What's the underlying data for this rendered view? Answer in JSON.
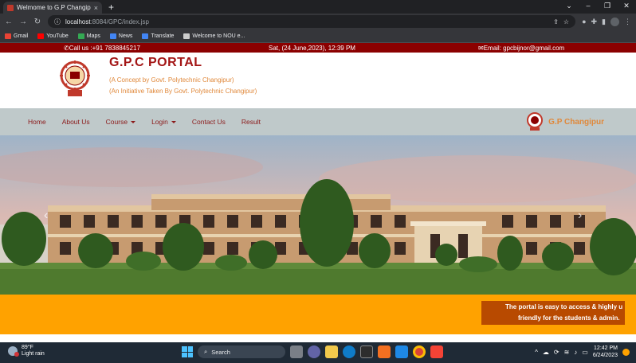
{
  "browser": {
    "tab_title": "Welmome to G.P Changipur Port",
    "close_glyph": "×",
    "new_tab_glyph": "+",
    "url_host": "localhost",
    "url_path": ":8084/GPC/index.jsp",
    "bookmarks": [
      {
        "label": "Gmail",
        "color": "#ea4335"
      },
      {
        "label": "YouTube",
        "color": "#ff0000"
      },
      {
        "label": "Maps",
        "color": "#34a853"
      },
      {
        "label": "News",
        "color": "#4285f4"
      },
      {
        "label": "Translate",
        "color": "#4285f4"
      },
      {
        "label": "Welcome to NOU e...",
        "color": "#cccccc"
      }
    ]
  },
  "topbar": {
    "phone": "Call us :+91 7838845217",
    "datetime": "Sat, (24 June,2023), 12:39 PM",
    "email": "Email: gpcbijnor@gmail.com"
  },
  "header": {
    "title": "G.P.C PORTAL",
    "tagline1": "(A Concept by Govt. Polytechnic Changipur)",
    "tagline2": "(An Initiative Taken By Govt. Polytechnic Changipur)"
  },
  "nav": {
    "items": [
      {
        "label": "Home",
        "dropdown": false
      },
      {
        "label": "About Us",
        "dropdown": false
      },
      {
        "label": "Course",
        "dropdown": true
      },
      {
        "label": "Login",
        "dropdown": true
      },
      {
        "label": "Contact Us",
        "dropdown": false
      },
      {
        "label": "Result",
        "dropdown": false
      }
    ],
    "brand": "G.P Changipur"
  },
  "carousel": {
    "prev_glyph": "‹",
    "next_glyph": "›"
  },
  "marquee": {
    "line1": "The portal is easy to access & highly u",
    "line2": "friendly for the students & admin."
  },
  "taskbar": {
    "temperature": "89°F",
    "weather": "Light rain",
    "search_label": "Search",
    "time": "12:42 PM",
    "date": "6/24/2023"
  },
  "colors": {
    "topbar": "#8b0000",
    "title": "#a31515",
    "accent_orange": "#e0883a",
    "navbar": "#bfc9ca",
    "marquee_band": "#ffa200",
    "marquee_box": "#b84a00"
  }
}
